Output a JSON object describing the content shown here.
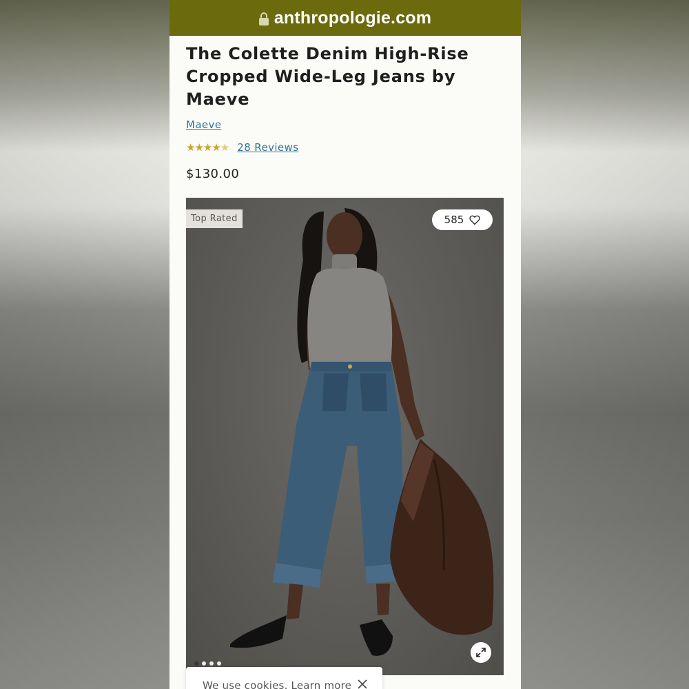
{
  "browser": {
    "domain": "anthropologie.com",
    "lock_icon": "lock-icon"
  },
  "product": {
    "title": "The Colette Denim High-Rise Cropped Wide-Leg Jeans by Maeve",
    "brand": "Maeve",
    "rating": 4.5,
    "stars_text": "★★★★",
    "stars_half": "★",
    "reviews_label": "28 Reviews",
    "price": "$130.00"
  },
  "gallery": {
    "badge": "Top Rated",
    "likes": "585",
    "heart_icon": "heart-icon",
    "expand_icon": "expand-icon",
    "image_count": 4,
    "active_index": 0
  },
  "cookie_banner": {
    "text": "We use cookies.",
    "link": "Learn more",
    "close_icon": "close-icon"
  },
  "colors": {
    "url_bar": "#6b6a0d",
    "link": "#2f7596",
    "star": "#c9a227",
    "page_bg": "#fbfbf8"
  }
}
